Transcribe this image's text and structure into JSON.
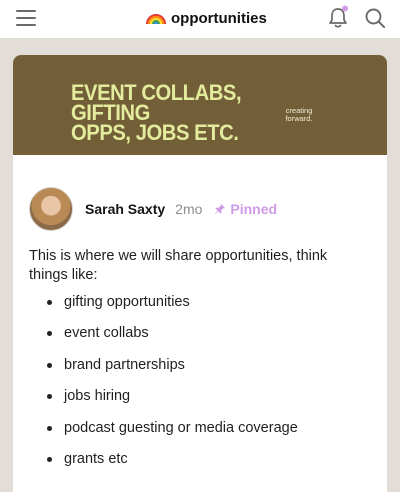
{
  "header": {
    "channel_emoji": "rainbow-icon",
    "channel_name": "opportunities"
  },
  "banner": {
    "heading_line1": "EVENT COLLABS, GIFTING",
    "heading_line2": "OPPS, JOBS ETC.",
    "logo_line1": "creating",
    "logo_line2": "forward."
  },
  "post": {
    "author": "Sarah Saxty",
    "age": "2mo",
    "pinned_label": "Pinned",
    "intro": "This is where we will share opportunities, think things like:",
    "items": [
      "gifting opportunities",
      "event collabs",
      "brand partnerships",
      "jobs hiring",
      "podcast guesting or media coverage",
      "grants etc"
    ]
  },
  "colors": {
    "banner_bg": "#725f38",
    "banner_text": "#e3eb9d",
    "pinned_accent": "#cf9ae6",
    "page_bg": "#e3ddd7"
  }
}
